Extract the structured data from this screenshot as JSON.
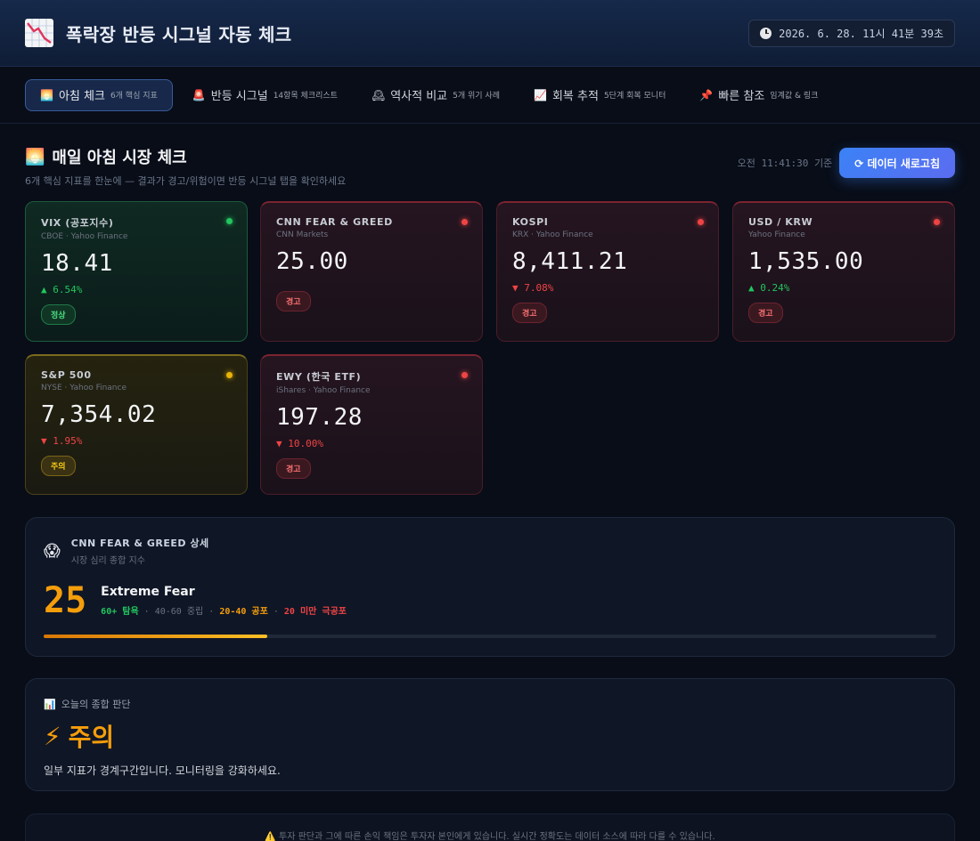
{
  "app": {
    "title": "폭락장 반등 시그널 자동 체크",
    "logo_icon": "chart-decreasing-icon",
    "clock_text": "2026. 6. 28. 11시 41분 39초"
  },
  "tabs": [
    {
      "icon": "🌅",
      "label": "아침 체크",
      "sub": "6개 핵심 지표",
      "active": true
    },
    {
      "icon": "🚨",
      "label": "반등 시그널",
      "sub": "14항목 체크리스트",
      "active": false
    },
    {
      "icon": "🕰",
      "label": "역사적 비교",
      "sub": "5개 위기 사례",
      "active": false
    },
    {
      "icon": "📈",
      "label": "회복 추적",
      "sub": "5단계 회복 모니터",
      "active": false
    },
    {
      "icon": "📌",
      "label": "빠른 참조",
      "sub": "임계값 & 링크",
      "active": false
    }
  ],
  "section": {
    "icon": "🌅",
    "title": "매일 아침 시장 체크",
    "subtitle": "6개 핵심 지표를 한눈에 — 결과가 경고/위험이면 반등 시그널 탭을 확인하세요",
    "timestamp": "오전 11:41:30 기준",
    "refresh_label": "⟳ 데이터 새로고침"
  },
  "cards": [
    {
      "title": "VIX (공포지수)",
      "source": "CBOE · Yahoo Finance",
      "value": "18.41",
      "change": "▲ 6.54%",
      "direction": "up",
      "status": "정상",
      "tone": "green"
    },
    {
      "title": "CNN FEAR & GREED",
      "source": "CNN Markets",
      "value": "25.00",
      "change": "",
      "direction": "",
      "status": "경고",
      "tone": "red"
    },
    {
      "title": "KOSPI",
      "source": "KRX · Yahoo Finance",
      "value": "8,411.21",
      "change": "▼ 7.08%",
      "direction": "down",
      "status": "경고",
      "tone": "red"
    },
    {
      "title": "USD / KRW",
      "source": "Yahoo Finance",
      "value": "1,535.00",
      "change": "▲ 0.24%",
      "direction": "up",
      "status": "경고",
      "tone": "red"
    },
    {
      "title": "S&P 500",
      "source": "NYSE · Yahoo Finance",
      "value": "7,354.02",
      "change": "▼ 1.95%",
      "direction": "down",
      "status": "주의",
      "tone": "yellow"
    },
    {
      "title": "EWY (한국 ETF)",
      "source": "iShares · Yahoo Finance",
      "value": "197.28",
      "change": "▼ 10.00%",
      "direction": "down",
      "status": "경고",
      "tone": "red"
    }
  ],
  "fear_greed": {
    "icon": "😱",
    "title": "CNN FEAR & GREED 상세",
    "subtitle": "시장 심리 종합 지수",
    "score": "25",
    "label": "Extreme Fear",
    "legend": {
      "greed": "60+ 탐욕",
      "sep1": " · 40-60 중립 · ",
      "fear": "20-40 공포",
      "sep2": " · ",
      "extreme": "20 미만 극공포"
    },
    "level": 0.25
  },
  "verdict": {
    "icon": "📊",
    "heading": "오늘의 종합 판단",
    "main_icon": "⚡",
    "main": "주의",
    "text": "일부 지표가 경계구간입니다. 모니터링을 강화하세요."
  },
  "disclaimer": "⚠️ 투자 판단과 그에 따른 손익 책임은 투자자 본인에게 있습니다. 실시간 정확도는 데이터 소스에 따라 다를 수 있습니다."
}
